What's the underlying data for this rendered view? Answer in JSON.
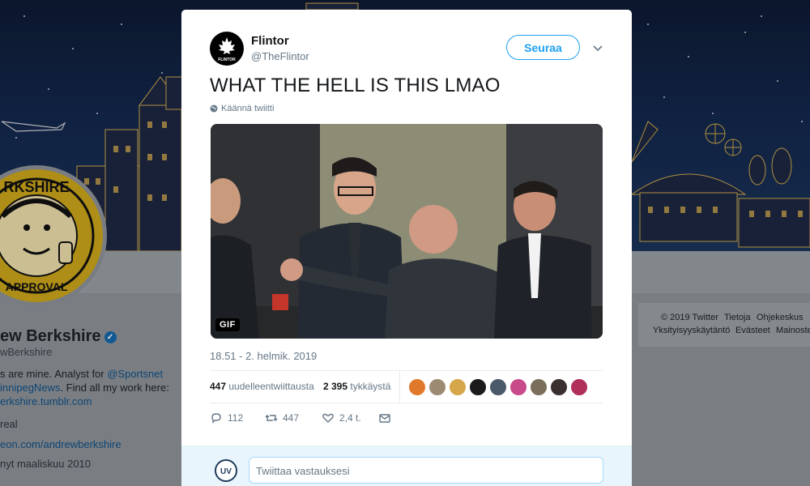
{
  "tweet": {
    "author_name": "Flintor",
    "author_handle": "@TheFlintor",
    "avatar_text": "FLINTOR",
    "follow_label": "Seuraa",
    "text": "WHAT THE HELL IS THIS LMAO",
    "translate_label": "Käännä twiitti",
    "media_badge": "GIF",
    "timestamp": "18.51 - 2. helmik. 2019",
    "retweets_count": "447",
    "retweets_label": "uudelleentwiittausta",
    "likes_count": "2 395",
    "likes_label": "tykkäystä",
    "liker_colors": [
      "#e07a2a",
      "#9c8a73",
      "#d6a64b",
      "#1b1b1b",
      "#4b5a6a",
      "#c94a8a",
      "#7a6f5a",
      "#3a3030",
      "#b0305a"
    ],
    "reply_count": "112",
    "retweet_action_count": "447",
    "like_action_count": "2,4 t.",
    "reply_placeholder": "Twiittaa vastauksesi",
    "reply_avatar_text": "UV"
  },
  "background_profile": {
    "name": "ew Berkshire",
    "handle": "wBerkshire",
    "avatar_text": "RKSHIRE",
    "avatar_bottom_text": "APPROVAL",
    "bio_line1": "s are mine. Analyst for ",
    "bio_link1": "@Sportsnet",
    "bio_line2_link": "innipegNews",
    "bio_line2_rest": ". Find all my work here:",
    "bio_line3_link": "erkshire.tumblr.com",
    "location": "real",
    "website": "eon.com/andrewberkshire",
    "joined": "nyt maaliskuu 2010"
  },
  "footer": {
    "copyright": "© 2019 Twitter",
    "about": "Tietoja",
    "help": "Ohjekeskus",
    "privacy": "Yksityisyyskäytäntö",
    "cookies": "Evästeet",
    "ads": "Mainoste"
  },
  "colors": {
    "accent": "#1da1f2",
    "banner_dark": "#0d1a33",
    "building_gold": "#c9a44a"
  }
}
